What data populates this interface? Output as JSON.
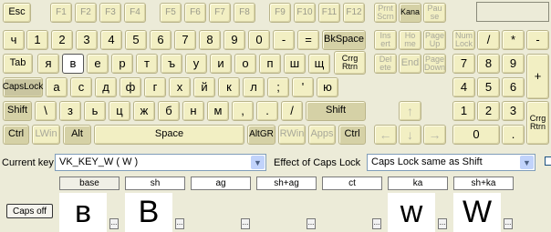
{
  "keys": {
    "esc": "Esc",
    "f1": "F1",
    "f2": "F2",
    "f3": "F3",
    "f4": "F4",
    "f5": "F5",
    "f6": "F6",
    "f7": "F7",
    "f8": "F8",
    "f9": "F9",
    "f10": "F10",
    "f11": "F11",
    "f12": "F12",
    "prtscrn": "Prnt Scrn",
    "kana": "Kana",
    "pause": "Pau se",
    "grave": "ч",
    "d1": "1",
    "d2": "2",
    "d3": "3",
    "d4": "4",
    "d5": "5",
    "d6": "6",
    "d7": "7",
    "d8": "8",
    "d9": "9",
    "d0": "0",
    "minus": "-",
    "equals": "=",
    "backspace": "BkSpace",
    "insert": "Ins ert",
    "home": "Ho me",
    "pageup": "Page Up",
    "numlock": "Num Lock",
    "numdiv": "/",
    "nummul": "*",
    "numsub": "-",
    "tab": "Tab",
    "q": "я",
    "w": "в",
    "e": "е",
    "r": "р",
    "t": "т",
    "y": "ъ",
    "u": "у",
    "i": "и",
    "o": "о",
    "p": "п",
    "lbracket": "ш",
    "rbracket": "щ",
    "enter": "Crrg Rtrn",
    "delete": "Del ete",
    "end": "End",
    "pagedown": "Page Down",
    "num7": "7",
    "num8": "8",
    "num9": "9",
    "numadd": "+",
    "capslock": "CapsLock",
    "a": "а",
    "s": "с",
    "d": "д",
    "f": "ф",
    "g": "г",
    "h": "х",
    "j": "й",
    "k": "к",
    "l": "л",
    "semicolon": ";",
    "quote": "'",
    "backslash": "ю",
    "num4": "4",
    "num5": "5",
    "num6": "6",
    "lshift": "Shift",
    "oem102": "\\",
    "z": "з",
    "x": "ь",
    "c": "ц",
    "v": "ж",
    "b": "б",
    "n": "н",
    "m": "м",
    "comma": ",",
    "period": ".",
    "slash": "/",
    "rshift": "Shift",
    "up": "↑",
    "num1": "1",
    "num2": "2",
    "num3": "3",
    "numenter": "Crrg Rtrn",
    "lctrl": "Ctrl",
    "lwin": "LWin",
    "alt": "Alt",
    "space": "Space",
    "altgr": "AltGR",
    "rwin": "RWin",
    "apps": "Apps",
    "rctrl": "Ctrl",
    "left": "←",
    "down": "↓",
    "right": "→",
    "num0": "0",
    "numdot": "."
  },
  "controls": {
    "current_key_label": "Current key",
    "current_key_value": "VK_KEY_W ( W )",
    "caps_label": "Effect of Caps Lock",
    "caps_value": "Caps Lock same as Shift"
  },
  "tabs": [
    "base",
    "sh",
    "ag",
    "sh+ag",
    "ct",
    "ka",
    "sh+ka"
  ],
  "caps_button": "Caps off",
  "previews": [
    "в",
    "В",
    "",
    "",
    "",
    "w",
    "W"
  ],
  "dots_label": "..."
}
